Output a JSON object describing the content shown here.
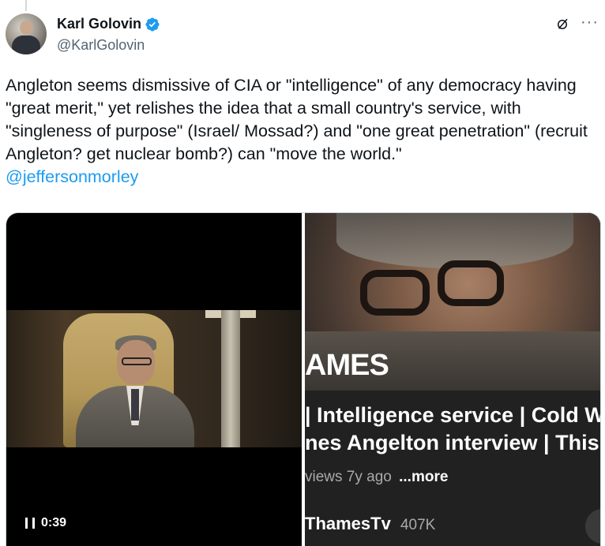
{
  "author": {
    "name": "Karl Golovin",
    "handle": "@KarlGolovin",
    "verified": true,
    "verified_color": "#1d9bf0"
  },
  "icons": {
    "grok": "grok-icon",
    "more": "···"
  },
  "tweet": {
    "text": "Angleton seems dismissive of CIA or \"intelligence\" of any democracy having \"great merit,\" yet relishes the idea that a small country's service, with \"singleness of purpose\" (Israel/ Mossad?) and \"one great penetration\" (recruit Angleton? get nuclear bomb?) can \"move the world.\"",
    "mention": "@jeffersonmorley"
  },
  "media": {
    "left_video": {
      "elapsed": "0:39",
      "state": "playing"
    },
    "right_image": {
      "title_fragment": "AMES",
      "video_title_line1": "| Intelligence service | Cold W",
      "video_title_line2": "nes Angelton interview | This",
      "meta_views": "views",
      "meta_age": "7y ago",
      "meta_more": "...more",
      "channel": "ThamesTv",
      "subscribers": "407K"
    }
  },
  "colors": {
    "text": "#0f1419",
    "secondary": "#536471",
    "link": "#1d9bf0"
  }
}
